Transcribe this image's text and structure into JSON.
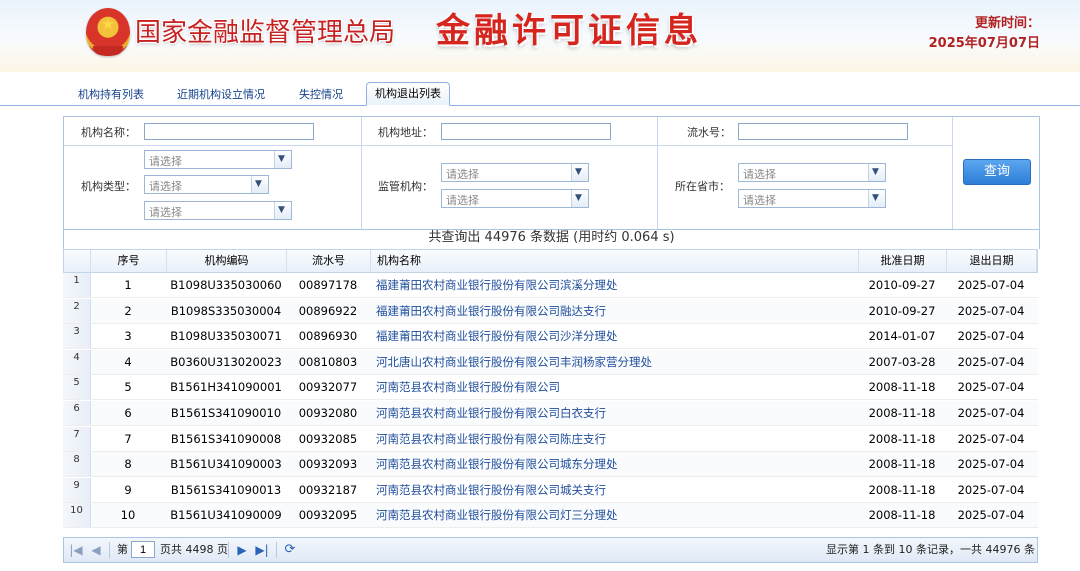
{
  "header": {
    "org_name": "国家金融监督管理总局",
    "site_title": "金融许可证信息",
    "update_label": "更新时间：",
    "update_date": "2025年07月07日"
  },
  "tabs": [
    {
      "label": "机构持有列表",
      "active": false
    },
    {
      "label": "近期机构设立情况",
      "active": false
    },
    {
      "label": "失控情况",
      "active": false
    },
    {
      "label": "机构退出列表",
      "active": true
    }
  ],
  "search": {
    "institution_name_label": "机构名称：",
    "institution_name_value": "",
    "address_label": "机构地址：",
    "address_value": "",
    "serial_label": "流水号：",
    "serial_value": "",
    "type_label": "机构类型：",
    "type_selects": [
      "请选择",
      "请选择",
      "请选择"
    ],
    "regulator_label": "监管机构：",
    "regulator_selects": [
      "请选择",
      "请选择"
    ],
    "province_label": "所在省市：",
    "province_selects": [
      "请选择",
      "请选择"
    ],
    "query_button": "查询"
  },
  "result_summary": "共查询出 44976 条数据 (用时约 0.064 s)",
  "table": {
    "columns": [
      "序号",
      "机构编码",
      "流水号",
      "机构名称",
      "批准日期",
      "退出日期"
    ],
    "rows": [
      {
        "n": "1",
        "seq": "1",
        "code": "B1098U335030060",
        "serial": "00897178",
        "name": "福建莆田农村商业银行股份有限公司滨溪分理处",
        "approve": "2010-09-27",
        "exit": "2025-07-04"
      },
      {
        "n": "2",
        "seq": "2",
        "code": "B1098S335030004",
        "serial": "00896922",
        "name": "福建莆田农村商业银行股份有限公司融达支行",
        "approve": "2010-09-27",
        "exit": "2025-07-04"
      },
      {
        "n": "3",
        "seq": "3",
        "code": "B1098U335030071",
        "serial": "00896930",
        "name": "福建莆田农村商业银行股份有限公司沙洋分理处",
        "approve": "2014-01-07",
        "exit": "2025-07-04"
      },
      {
        "n": "4",
        "seq": "4",
        "code": "B0360U313020023",
        "serial": "00810803",
        "name": "河北唐山农村商业银行股份有限公司丰润杨家营分理处",
        "approve": "2007-03-28",
        "exit": "2025-07-04"
      },
      {
        "n": "5",
        "seq": "5",
        "code": "B1561H341090001",
        "serial": "00932077",
        "name": "河南范县农村商业银行股份有限公司",
        "approve": "2008-11-18",
        "exit": "2025-07-04"
      },
      {
        "n": "6",
        "seq": "6",
        "code": "B1561S341090010",
        "serial": "00932080",
        "name": "河南范县农村商业银行股份有限公司白衣支行",
        "approve": "2008-11-18",
        "exit": "2025-07-04"
      },
      {
        "n": "7",
        "seq": "7",
        "code": "B1561S341090008",
        "serial": "00932085",
        "name": "河南范县农村商业银行股份有限公司陈庄支行",
        "approve": "2008-11-18",
        "exit": "2025-07-04"
      },
      {
        "n": "8",
        "seq": "8",
        "code": "B1561U341090003",
        "serial": "00932093",
        "name": "河南范县农村商业银行股份有限公司城东分理处",
        "approve": "2008-11-18",
        "exit": "2025-07-04"
      },
      {
        "n": "9",
        "seq": "9",
        "code": "B1561S341090013",
        "serial": "00932187",
        "name": "河南范县农村商业银行股份有限公司城关支行",
        "approve": "2008-11-18",
        "exit": "2025-07-04"
      },
      {
        "n": "10",
        "seq": "10",
        "code": "B1561U341090009",
        "serial": "00932095",
        "name": "河南范县农村商业银行股份有限公司灯三分理处",
        "approve": "2008-11-18",
        "exit": "2025-07-04"
      }
    ]
  },
  "pager": {
    "page_prefix": "第",
    "page_value": "1",
    "page_suffix": "页共 4498 页",
    "display_info": "显示第 1 条到 10 条记录，一共 44976 条",
    "icons": [
      "first-page-icon",
      "prev-page-icon",
      "next-page-icon",
      "last-page-icon",
      "refresh-icon"
    ]
  },
  "colors": {
    "title_red": "#c62221",
    "link_blue": "#1f4e9c",
    "border_blue": "#aac4e6",
    "button_blue": "#2c7ed8"
  }
}
